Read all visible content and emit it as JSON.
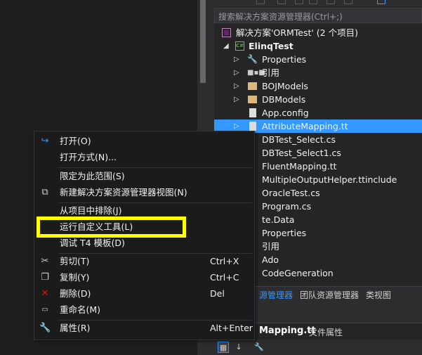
{
  "solution_explorer": {
    "search_placeholder": "搜索解决方案资源管理器(Ctrl+;)",
    "solution_label": "解决方案'ORMTest' (2 个项目)",
    "project_badge": "C#",
    "project_label": "ElinqTest",
    "items": [
      {
        "label": "Properties",
        "icon": "wrench-icon"
      },
      {
        "label": "引用",
        "icon": "references-icon"
      },
      {
        "label": "BOJModels",
        "icon": "folder-icon"
      },
      {
        "label": "DBModels",
        "icon": "folder-icon"
      },
      {
        "label": "App.config",
        "icon": "config-file-icon"
      },
      {
        "label": "AttributeMapping.tt",
        "icon": "file-icon",
        "selected": true
      }
    ],
    "partial_items": [
      "DBTest_Select.cs",
      "DBTest_Select1.cs",
      "FluentMapping.tt",
      "MultipleOutputHelper.ttinclude",
      "OracleTest.cs",
      "Program.cs",
      "te.Data",
      "Properties",
      "引用",
      "Ado",
      "CodeGeneration"
    ]
  },
  "bottom_tabs": [
    {
      "label": "源管理器",
      "active": true
    },
    {
      "label": "团队资源管理器",
      "active": false
    },
    {
      "label": "类视图",
      "active": false
    }
  ],
  "properties": {
    "file_name": "Mapping.tt",
    "subtitle": "文件属性"
  },
  "context_menu": {
    "items": [
      {
        "label": "打开(O)",
        "shortcut": "",
        "icon": "open-arrow-icon"
      },
      {
        "label": "打开方式(N)...",
        "shortcut": "",
        "icon": ""
      },
      {
        "label": "限定为此范围(S)",
        "shortcut": "",
        "icon": ""
      },
      {
        "label": "新建解决方案资源管理器视图(N)",
        "shortcut": "",
        "icon": "new-view-icon"
      },
      {
        "label": "从项目中排除(J)",
        "shortcut": "",
        "icon": ""
      },
      {
        "label": "运行自定义工具(L)",
        "shortcut": "",
        "icon": "",
        "highlighted": true
      },
      {
        "label": "调试 T4 模板(D)",
        "shortcut": "",
        "icon": ""
      },
      {
        "label": "剪切(T)",
        "shortcut": "Ctrl+X",
        "icon": "scissors-icon"
      },
      {
        "label": "复制(Y)",
        "shortcut": "Ctrl+C",
        "icon": "copy-icon"
      },
      {
        "label": "删除(D)",
        "shortcut": "Del",
        "icon": "delete-x-icon"
      },
      {
        "label": "重命名(M)",
        "shortcut": "",
        "icon": "rename-icon"
      },
      {
        "label": "属性(R)",
        "shortcut": "Alt+Enter",
        "icon": "wrench-icon"
      }
    ]
  },
  "colors": {
    "selection": "#3399ff",
    "highlight_box": "#ffff00",
    "menu_bg": "#1b1b1c",
    "panel_bg": "#252526"
  }
}
